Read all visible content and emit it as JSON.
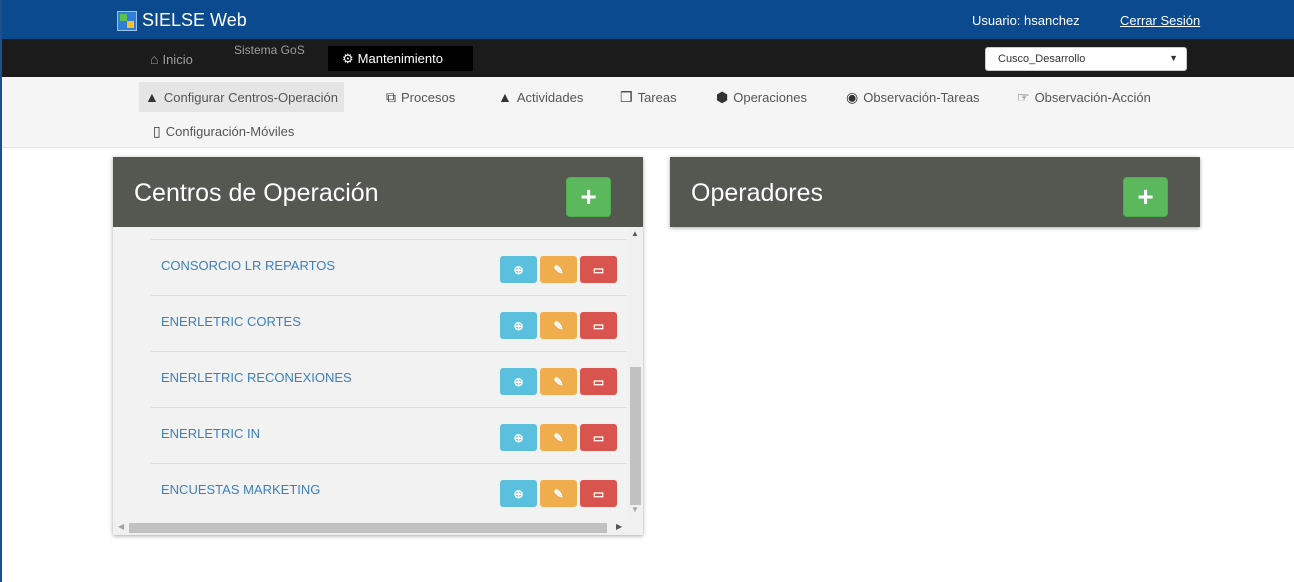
{
  "app": {
    "title": "SIELSE Web"
  },
  "user": {
    "label": "Usuario: hsanchez",
    "logout": "Cerrar Sesión"
  },
  "nav": {
    "home": "Inicio",
    "system": "Sistema GoS",
    "maintenance": "Mantenimiento",
    "environment": "Cusco_Desarrollo"
  },
  "submenu": [
    {
      "label": "Configurar Centros-Operación",
      "icon": "sitemap-icon",
      "active": true
    },
    {
      "label": "Procesos",
      "icon": "clone-icon"
    },
    {
      "label": "Actividades",
      "icon": "sitemap-icon"
    },
    {
      "label": "Tareas",
      "icon": "cubes-icon"
    },
    {
      "label": "Operaciones",
      "icon": "cube-icon"
    },
    {
      "label": "Observación-Tareas",
      "icon": "binoculars-icon"
    },
    {
      "label": "Observación-Acción",
      "icon": "handshake-icon"
    },
    {
      "label": "Configuración-Móviles",
      "icon": "mobile-icon"
    }
  ],
  "centros": {
    "title": "Centros de Operación",
    "add_label": "+",
    "items": [
      {
        "name": "CONSORCIO LR REPARTOS"
      },
      {
        "name": "ENERLETRIC CORTES"
      },
      {
        "name": "ENERLETRIC RECONEXIONES"
      },
      {
        "name": "ENERLETRIC IN"
      },
      {
        "name": "ENCUESTAS MARKETING"
      }
    ]
  },
  "operadores": {
    "title": "Operadores",
    "add_label": "+"
  },
  "colors": {
    "primary": "#0b4a8f",
    "panel_header": "#555751",
    "success": "#5cb85c",
    "info": "#5bc0de",
    "warning": "#f0ad4e",
    "danger": "#d9534f",
    "link": "#3c7fbe"
  }
}
